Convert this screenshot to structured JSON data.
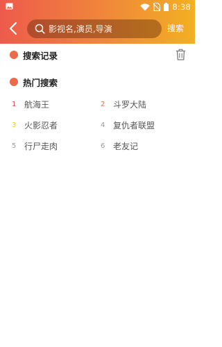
{
  "status_bar": {
    "time": "8:38",
    "icons": [
      "image-thumbnail-icon",
      "wifi-icon",
      "no-sim-icon",
      "battery-icon"
    ]
  },
  "header": {
    "back_icon": "chevron-left-icon",
    "search": {
      "placeholder": "影视名,演员,导演",
      "value": ""
    },
    "search_button_label": "搜索"
  },
  "history": {
    "title": "搜索记录",
    "clear_icon": "trash-icon"
  },
  "hot": {
    "title": "热门搜索",
    "items": [
      {
        "rank": "1",
        "term": "航海王",
        "rank_color": "#e53935"
      },
      {
        "rank": "2",
        "term": "斗罗大陆",
        "rank_color": "#f26d3d"
      },
      {
        "rank": "3",
        "term": "火影忍者",
        "rank_color": "#f5c518"
      },
      {
        "rank": "4",
        "term": "复仇者联盟",
        "rank_color": "#9a9a9a"
      },
      {
        "rank": "5",
        "term": "行尸走肉",
        "rank_color": "#9a9a9a"
      },
      {
        "rank": "6",
        "term": "老友记",
        "rank_color": "#9a9a9a"
      }
    ]
  },
  "colors": {
    "gradient_start": "#ee5a4c",
    "gradient_mid": "#f0883a",
    "gradient_end": "#f2b022",
    "accent_dot": "#ec6a4a"
  }
}
